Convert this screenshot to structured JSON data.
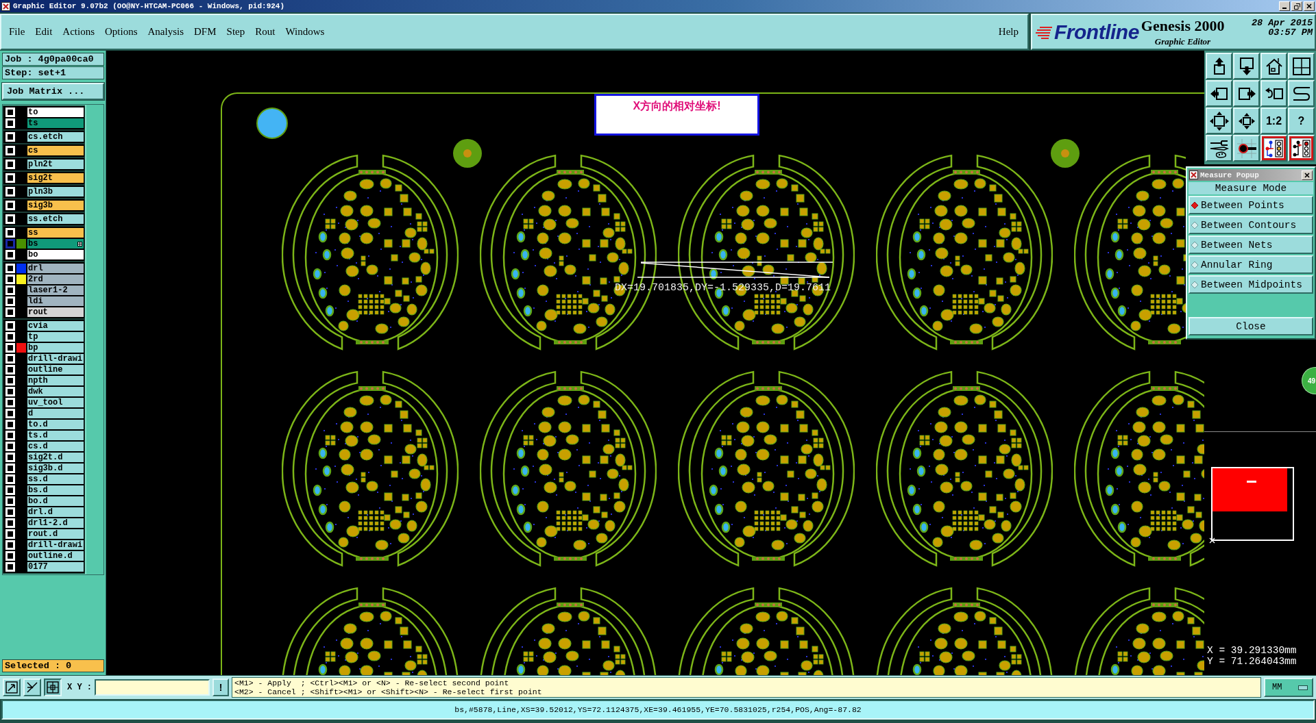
{
  "window": {
    "title": "Graphic Editor 9.07b2 (OO@NY-HTCAM-PC066 - Windows, pid:924)"
  },
  "menu": {
    "items": [
      "File",
      "Edit",
      "Actions",
      "Options",
      "Analysis",
      "DFM",
      "Step",
      "Rout",
      "Windows"
    ],
    "help": "Help"
  },
  "brand": {
    "logo": "Frontline",
    "product": "Genesis 2000",
    "subtitle": "Graphic Editor",
    "date": "28 Apr 2015",
    "time": "03:57 PM"
  },
  "job_panel": {
    "job": "Job : 4g0pa00ca0",
    "step": "Step: set+1",
    "matrix_button": "Job Matrix ...",
    "layer_groups": [
      {
        "layers": [
          {
            "name": "to",
            "color": "#ffffff",
            "checked": false,
            "work": false
          },
          {
            "name": "ts",
            "color": "#109a7a",
            "checked": false,
            "work": false
          }
        ]
      },
      {
        "layers": [
          {
            "name": "cs.etch",
            "color": "#9cdcdc",
            "checked": false,
            "work": false
          }
        ]
      },
      {
        "layers": [
          {
            "name": "cs",
            "color": "#f8c04c",
            "checked": false,
            "work": false
          }
        ]
      },
      {
        "layers": [
          {
            "name": "pln2t",
            "color": "#9cdcdc",
            "checked": false,
            "work": false
          }
        ]
      },
      {
        "layers": [
          {
            "name": "sig2t",
            "color": "#f8c04c",
            "checked": false,
            "work": false
          }
        ]
      },
      {
        "layers": [
          {
            "name": "pln3b",
            "color": "#9cdcdc",
            "checked": false,
            "work": false
          }
        ]
      },
      {
        "layers": [
          {
            "name": "sig3b",
            "color": "#f8c04c",
            "checked": false,
            "work": false
          }
        ]
      },
      {
        "layers": [
          {
            "name": "ss.etch",
            "color": "#9cdcdc",
            "checked": false,
            "work": false
          }
        ]
      },
      {
        "layers": [
          {
            "name": "ss",
            "color": "#f8c04c",
            "checked": false,
            "work": false
          },
          {
            "name": "bs",
            "color": "#109a7a",
            "swatch": {
              "color": "#4a9000"
            },
            "checked": false,
            "work": true
          },
          {
            "name": "bo",
            "color": "#ffffff",
            "checked": false,
            "work": false
          }
        ]
      },
      {
        "layers": [
          {
            "name": "drl",
            "color": "#a0b4c0",
            "swatch": {
              "color": "#0030f0"
            },
            "checked": false,
            "work": false
          },
          {
            "name": "2rd",
            "color": "#a0b4c0",
            "swatch": {
              "color": "#f8f020"
            },
            "checked": false,
            "work": false
          },
          {
            "name": "laser1-2",
            "color": "#a0b4c0",
            "checked": false,
            "work": false
          },
          {
            "name": "ldi",
            "color": "#a0b4c0",
            "checked": false,
            "work": false
          },
          {
            "name": "rout",
            "color": "#d4d4d4",
            "checked": false,
            "work": false
          }
        ]
      },
      {
        "layers": [
          {
            "name": "cvia",
            "color": "#9cdcdc",
            "checked": false,
            "work": false
          },
          {
            "name": "tp",
            "color": "#9cdcdc",
            "checked": false,
            "work": false
          },
          {
            "name": "bp",
            "color": "#9cdcdc",
            "swatch": {
              "color": "#f01010"
            },
            "checked": false,
            "work": false
          },
          {
            "name": "drill-drawi",
            "color": "#9cdcdc",
            "checked": false,
            "work": false
          },
          {
            "name": "outline",
            "color": "#9cdcdc",
            "checked": false,
            "work": false
          },
          {
            "name": "npth",
            "color": "#9cdcdc",
            "checked": false,
            "work": false
          },
          {
            "name": "dwk",
            "color": "#9cdcdc",
            "checked": false,
            "work": false
          },
          {
            "name": "uv_tool",
            "color": "#9cdcdc",
            "checked": false,
            "work": false
          },
          {
            "name": "d",
            "color": "#9cdcdc",
            "checked": false,
            "work": false
          },
          {
            "name": "to.d",
            "color": "#9cdcdc",
            "checked": false,
            "work": false
          },
          {
            "name": "ts.d",
            "color": "#9cdcdc",
            "checked": false,
            "work": false
          },
          {
            "name": "cs.d",
            "color": "#9cdcdc",
            "checked": false,
            "work": false
          },
          {
            "name": "sig2t.d",
            "color": "#9cdcdc",
            "checked": false,
            "work": false
          },
          {
            "name": "sig3b.d",
            "color": "#9cdcdc",
            "checked": false,
            "work": false
          },
          {
            "name": "ss.d",
            "color": "#9cdcdc",
            "checked": false,
            "work": false
          },
          {
            "name": "bs.d",
            "color": "#9cdcdc",
            "checked": false,
            "work": false
          },
          {
            "name": "bo.d",
            "color": "#9cdcdc",
            "checked": false,
            "work": false
          },
          {
            "name": "drl.d",
            "color": "#9cdcdc",
            "checked": false,
            "work": false
          },
          {
            "name": "drl1-2.d",
            "color": "#9cdcdc",
            "checked": false,
            "work": false
          },
          {
            "name": "rout.d",
            "color": "#9cdcdc",
            "checked": false,
            "work": false
          },
          {
            "name": "drill-drawi",
            "color": "#9cdcdc",
            "checked": false,
            "work": false
          },
          {
            "name": "outline.d",
            "color": "#9cdcdc",
            "checked": false,
            "work": false
          },
          {
            "name": "0177",
            "color": "#9cdcdc",
            "checked": false,
            "work": false
          }
        ]
      }
    ],
    "selected": "Selected : 0"
  },
  "canvas": {
    "note": "X方向的相对坐标!",
    "measure_readout": "DX=19.701835,DY=-1.529335,D=19.7611"
  },
  "toolbar": [
    {
      "highlighted": false
    },
    {
      "highlighted": false
    },
    {
      "highlighted": false
    },
    {
      "highlighted": false
    },
    {
      "highlighted": false
    },
    {
      "highlighted": false
    },
    {
      "highlighted": false
    },
    {
      "highlighted": false
    },
    {
      "highlighted": false
    },
    {
      "highlighted": false
    },
    {
      "label": "1:2",
      "highlighted": false
    },
    {
      "label": "?",
      "highlighted": false
    },
    {
      "highlighted": false
    },
    {
      "highlighted": false
    },
    {
      "highlighted": true
    },
    {
      "highlighted": true
    }
  ],
  "measure_popup": {
    "title": "Measure Popup",
    "heading": "Measure Mode",
    "modes": [
      {
        "label": "Between Points",
        "selected": true
      },
      {
        "label": "Between Contours",
        "selected": false
      },
      {
        "label": "Between Nets",
        "selected": false
      },
      {
        "label": "Annular Ring",
        "selected": false
      },
      {
        "label": "Between Midpoints",
        "selected": false
      }
    ],
    "close": "Close"
  },
  "side_badge": "49",
  "cursor": {
    "x": "X = 39.291330mm",
    "y": "Y = 71.264043mm"
  },
  "command_bar": {
    "tools": [
      {
        "pressed": false
      },
      {
        "pressed": false
      },
      {
        "pressed": true
      }
    ],
    "xy_label": "X Y :",
    "alert_button": "!",
    "hints": [
      "<M1> - Apply  ; <Ctrl><M1> or <N> - Re-select second point",
      "<M2> - Cancel ; <Shift><M1> or <Shift><N> - Re-select first point"
    ],
    "units": "MM"
  },
  "status_bar": "bs,#5878,Line,XS=39.52012,YS=72.1124375,XE=39.461955,YE=70.5831025,r254,POS,Ang=-87.82"
}
